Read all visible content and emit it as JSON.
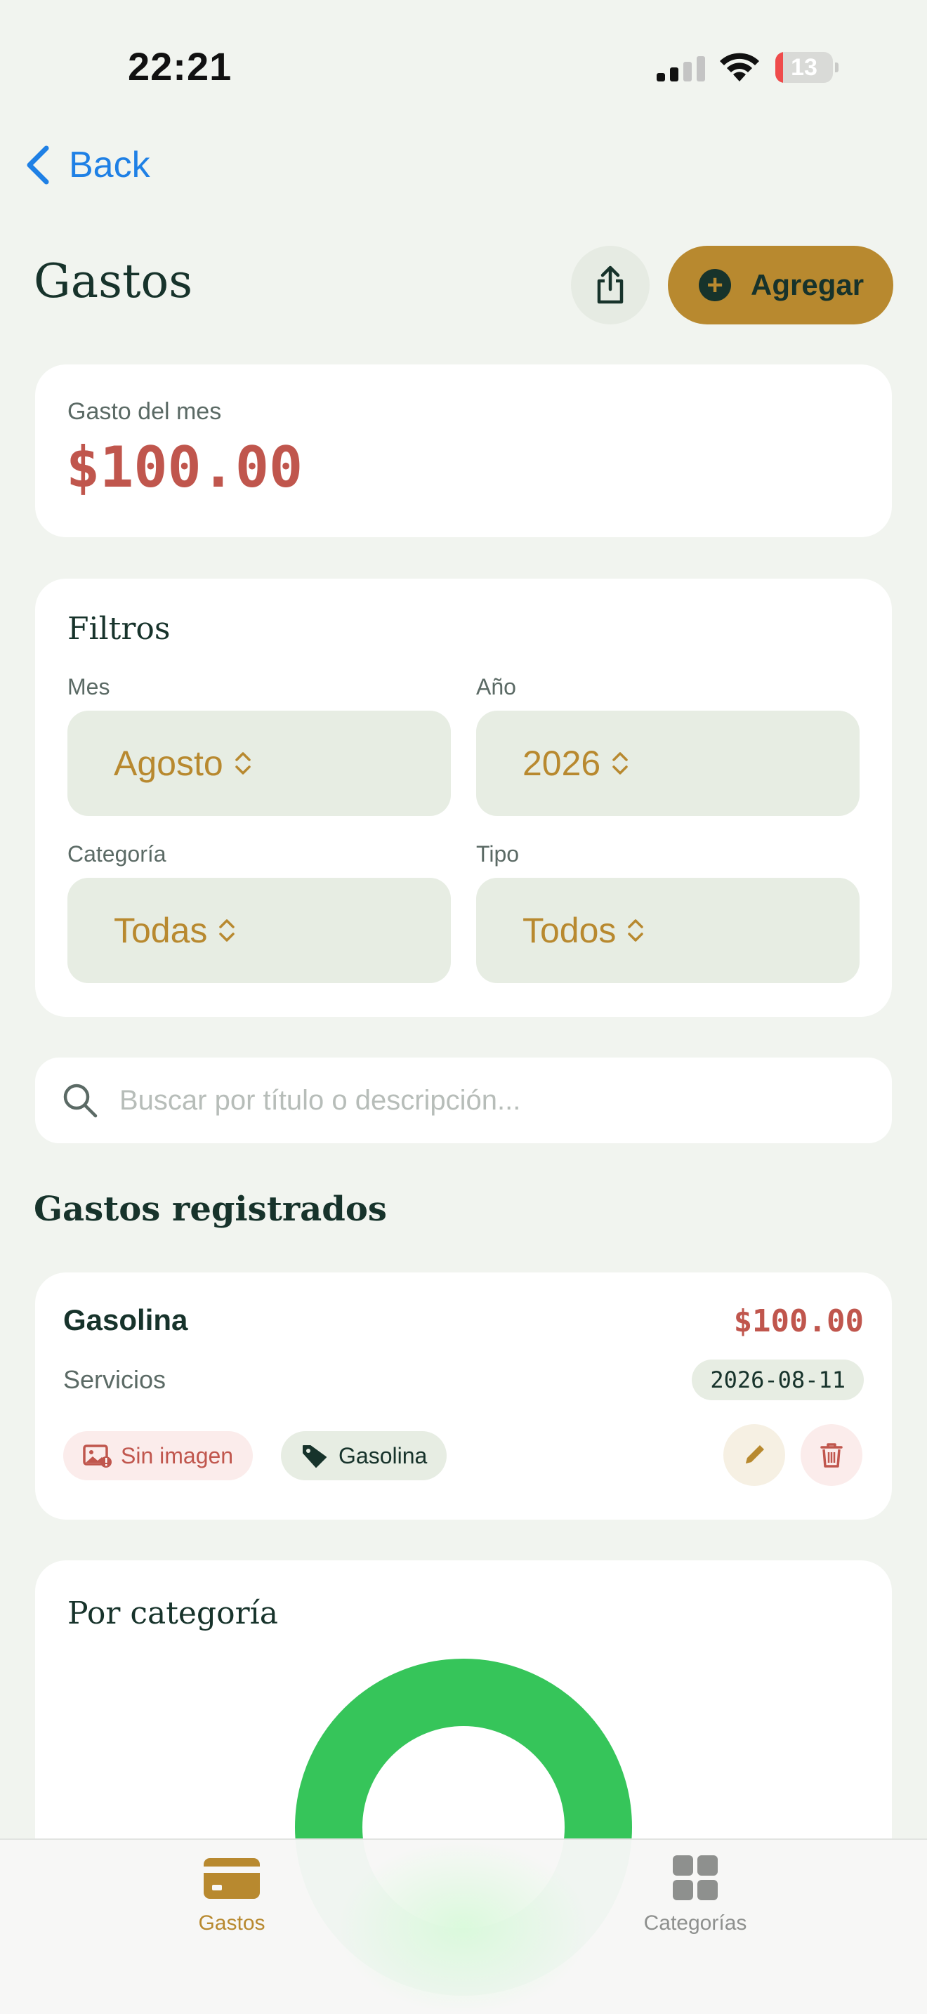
{
  "status_bar": {
    "time": "22:21",
    "battery_percent": "13",
    "battery_level": 0.13,
    "icons": [
      "cellular-signal-icon",
      "wifi-icon",
      "battery-icon"
    ]
  },
  "nav": {
    "back_label": "Back"
  },
  "header": {
    "title": "Gastos",
    "add_label": "Agregar",
    "share_icon": "share-icon"
  },
  "monthly": {
    "label": "Gasto del mes",
    "amount": "$100.00"
  },
  "filters": {
    "title": "Filtros",
    "month": {
      "label": "Mes",
      "value": "Agosto"
    },
    "year": {
      "label": "Año",
      "value": "2026"
    },
    "category": {
      "label": "Categoría",
      "value": "Todas"
    },
    "type": {
      "label": "Tipo",
      "value": "Todos"
    }
  },
  "search": {
    "placeholder": "Buscar por título o descripción..."
  },
  "expenses": {
    "section_title": "Gastos registrados",
    "items": [
      {
        "title": "Gasolina",
        "amount": "$100.00",
        "category": "Servicios",
        "date": "2026-08-11",
        "image_status": "Sin imagen",
        "tag": "Gasolina"
      }
    ]
  },
  "by_category": {
    "title": "Por categoría",
    "segment_color": "#36c55a"
  },
  "tab_bar": {
    "tabs": [
      {
        "label": "Gastos",
        "icon": "card-icon",
        "active": true
      },
      {
        "label": "Categorías",
        "icon": "grid-icon",
        "active": false
      }
    ]
  },
  "colors": {
    "accent": "#b8892f",
    "negative": "#c0564d",
    "link": "#1f80e5",
    "dark": "#17332b"
  }
}
